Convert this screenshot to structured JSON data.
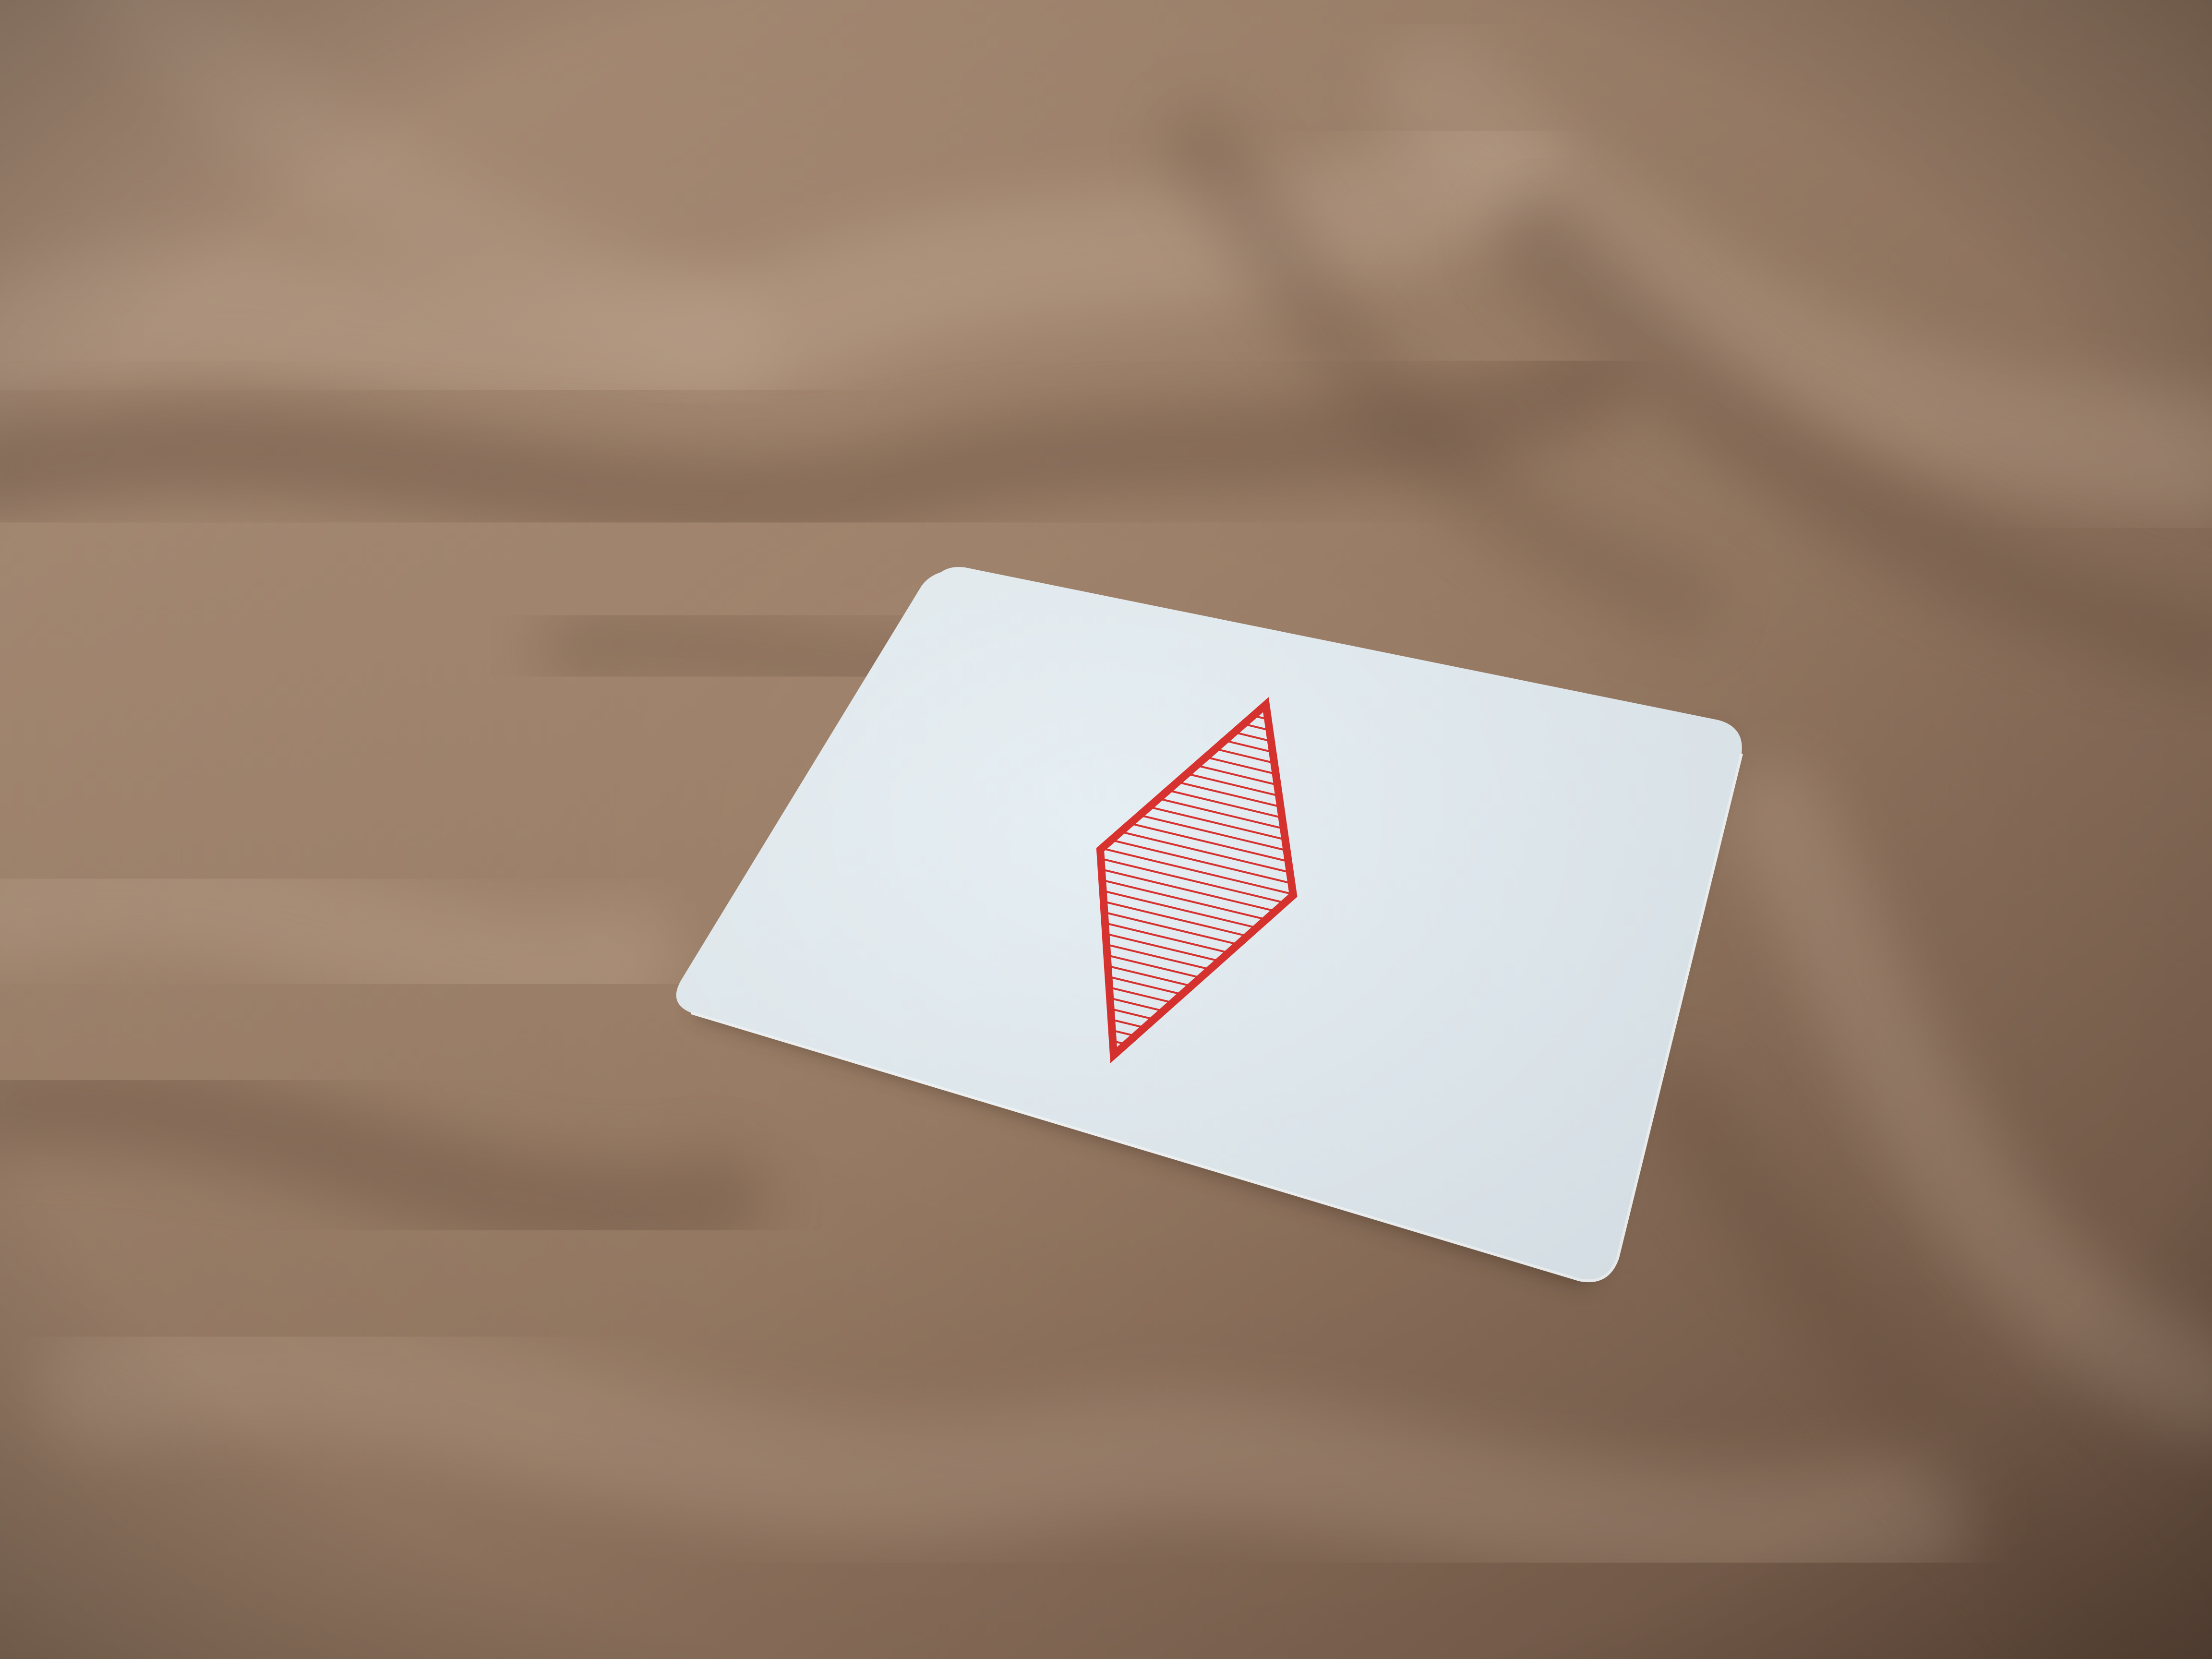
{
  "scene": {
    "subject": "playing-card-on-fabric",
    "colors": {
      "fabric_base": "#9a7d66",
      "fabric_light": "#b89a82",
      "fabric_shadow": "#6e5443",
      "fabric_highlight": "#c8ad96",
      "card_face": "#dfe9ef",
      "card_face_light": "#e9f1f5",
      "card_edge": "#f3f6f7",
      "card_shadow": "#4a3628",
      "diamond_red": "#d8322f"
    },
    "icons": {
      "card_pip": "diamond-icon"
    }
  }
}
